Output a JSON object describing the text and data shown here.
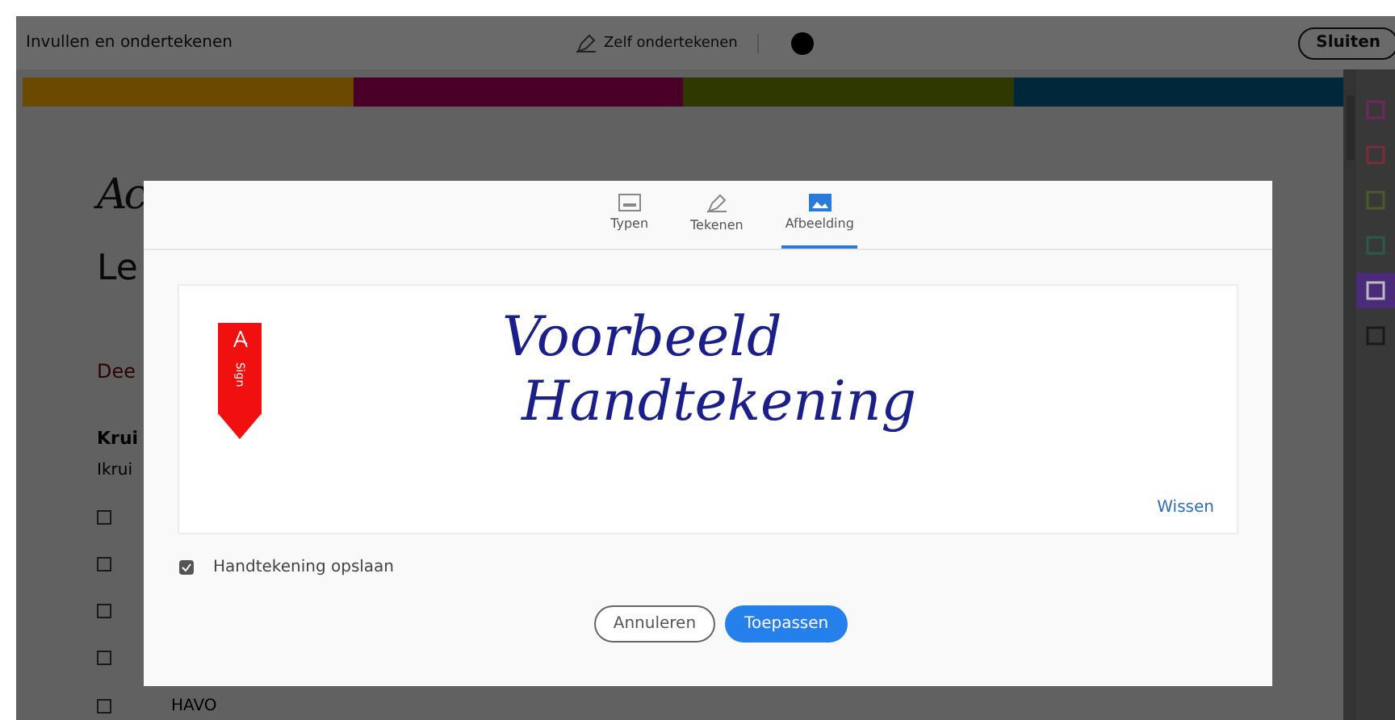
{
  "toolbar": {
    "title": "Invullen en ondertekenen",
    "sign_tool": "Zelf ondertekenen",
    "close_button": "Sluiten"
  },
  "color_bar": [
    {
      "color": "#6b4a00"
    },
    {
      "color": "#4a0026"
    },
    {
      "color": "#2e3800"
    },
    {
      "color": "#00273a"
    }
  ],
  "sidebar": {
    "tools": [
      {
        "color": "#6a2a5a",
        "selected": false
      },
      {
        "color": "#7a2a3a",
        "selected": false
      },
      {
        "color": "#4a5a2a",
        "selected": false
      },
      {
        "color": "#2a5a4a",
        "selected": false
      },
      {
        "color": "#4b2a7a",
        "selected": true
      },
      {
        "color": "#1a1a1a",
        "selected": false
      }
    ]
  },
  "document": {
    "heading": "Ac",
    "subheading": "Le",
    "section": "Dee",
    "question": "Krui",
    "instruction": "Ikrui",
    "option": "HAVO",
    "checkboxes": [
      {
        "checked": false
      },
      {
        "checked": false
      },
      {
        "checked": false
      },
      {
        "checked": false
      },
      {
        "checked": false
      }
    ]
  },
  "dialog": {
    "tabs": [
      {
        "kind": "type",
        "label": "Typen",
        "selected": false
      },
      {
        "kind": "draw",
        "label": "Tekenen",
        "selected": false
      },
      {
        "kind": "image",
        "label": "Afbeelding",
        "selected": true
      }
    ],
    "sign_tag": "Sign",
    "signature": [
      "Voorbeeld",
      "Handtekening"
    ],
    "clear_link": "Wissen",
    "save_option": {
      "label": "Handtekening opslaan",
      "checked": true
    },
    "buttons": [
      {
        "kind": "secondary",
        "label": "Annuleren"
      },
      {
        "kind": "primary",
        "label": "Toepassen"
      }
    ]
  }
}
